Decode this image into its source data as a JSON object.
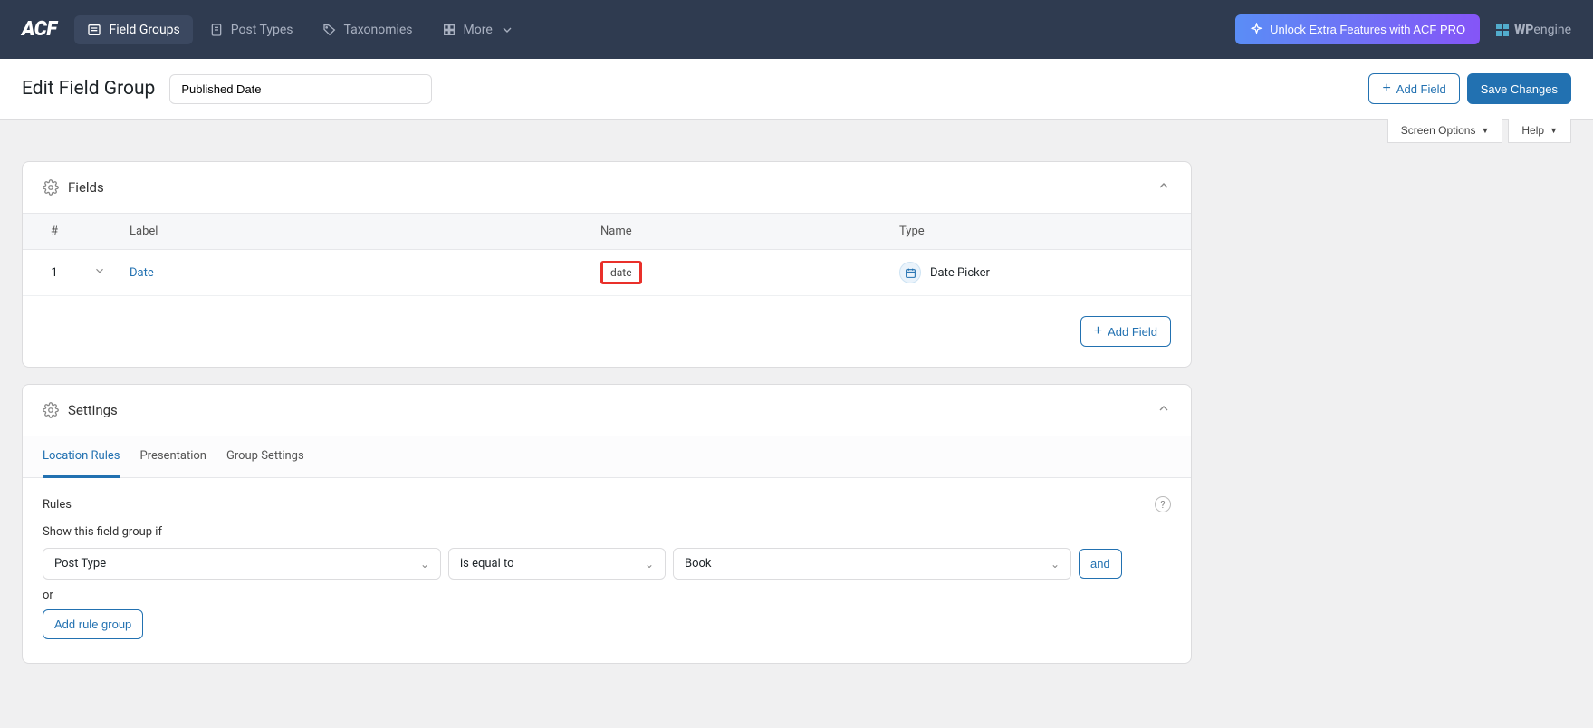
{
  "nav": {
    "logo": "ACF",
    "items": [
      {
        "label": "Field Groups"
      },
      {
        "label": "Post Types"
      },
      {
        "label": "Taxonomies"
      },
      {
        "label": "More"
      }
    ],
    "unlock": "Unlock Extra Features with ACF PRO",
    "wpengine_prefix": "WP",
    "wpengine_suffix": "engine"
  },
  "header": {
    "title": "Edit Field Group",
    "group_name": "Published Date",
    "add_field": "Add Field",
    "save": "Save Changes"
  },
  "screenopts": {
    "screen_options": "Screen Options",
    "help": "Help"
  },
  "fields_panel": {
    "title": "Fields",
    "columns": {
      "order": "#",
      "label": "Label",
      "name": "Name",
      "type": "Type"
    },
    "rows": [
      {
        "order": "1",
        "label": "Date",
        "name": "date",
        "type": "Date Picker"
      }
    ],
    "add_field": "Add Field"
  },
  "settings_panel": {
    "title": "Settings",
    "tabs": [
      {
        "label": "Location Rules",
        "active": true
      },
      {
        "label": "Presentation",
        "active": false
      },
      {
        "label": "Group Settings",
        "active": false
      }
    ],
    "rules_heading": "Rules",
    "rules_sub": "Show this field group if",
    "rule": {
      "param": "Post Type",
      "operator": "is equal to",
      "value": "Book"
    },
    "and": "and",
    "or": "or",
    "addgroup": "Add rule group"
  }
}
